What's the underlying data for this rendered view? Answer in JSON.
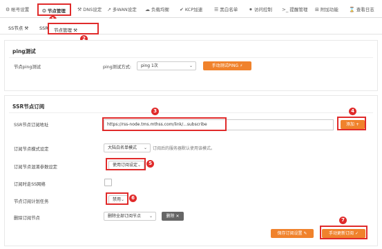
{
  "topnav": {
    "items": [
      {
        "icon": "gear-icon",
        "glyph": "⚙",
        "label": "帐号设置"
      },
      {
        "icon": "node-icon",
        "glyph": "❂",
        "label": "节点管理"
      },
      {
        "icon": "tools-icon",
        "glyph": "⚒",
        "label": "DNS设定"
      },
      {
        "icon": "route-icon",
        "glyph": "↗",
        "label": "多WAN设定"
      },
      {
        "icon": "cloud-icon",
        "glyph": "☁",
        "label": "负载均衡"
      },
      {
        "icon": "kcp-icon",
        "glyph": "✔",
        "label": "KCP加速"
      },
      {
        "icon": "list-icon",
        "glyph": "☰",
        "label": "黑白名单"
      },
      {
        "icon": "lock-icon",
        "glyph": "🔒",
        "label": "访问控制"
      },
      {
        "icon": "terminal-icon",
        "glyph": ">_",
        "label": "提醒管理"
      },
      {
        "icon": "plugin-icon",
        "glyph": "⊞",
        "label": "附加功能"
      },
      {
        "icon": "log-icon",
        "glyph": "⌛",
        "label": "查看日志"
      }
    ]
  },
  "subnav": {
    "tabs": [
      {
        "label": "SS节点 ⚒"
      },
      {
        "label": "SSR节点 ⚒"
      },
      {
        "label": "节点管理 ⚒"
      }
    ]
  },
  "ping": {
    "title": "ping测试",
    "row_label": "节点ping测试",
    "method_label": "ping测试方式:",
    "method_value": "ping 1次",
    "button": "手动测试PING ⚡"
  },
  "ssr": {
    "title": "SSR节点订阅",
    "url_label": "SSR节点订阅地址",
    "url_value": "https://rss-node.tms.mthss.com/link/...subscribe",
    "add_button": "添加 +",
    "mode_label": "订阅节点模式设定",
    "mode_value": "大陆白名单模式",
    "mode_hint": "订阅后的服务器默认使用该模式。",
    "obfs_label": "订阅节点混淆参数设定",
    "obfs_value": "使用订阅设定",
    "ss_label": "订阅时走SS网络",
    "schedule_label": "节点订阅计划任务",
    "schedule_value": "禁用",
    "delete_label": "删除订阅节点",
    "delete_select": "删除全部订阅节点",
    "delete_button": "删除 ✕",
    "save_button": "保存订阅设置 ✎",
    "update_button": "手动更新订阅 ✓"
  },
  "badges": [
    "1",
    "2",
    "3",
    "4",
    "5",
    "6",
    "7"
  ],
  "colors": {
    "accent": "#f0822c",
    "highlight": "#e02a2a",
    "delete": "#666666"
  }
}
